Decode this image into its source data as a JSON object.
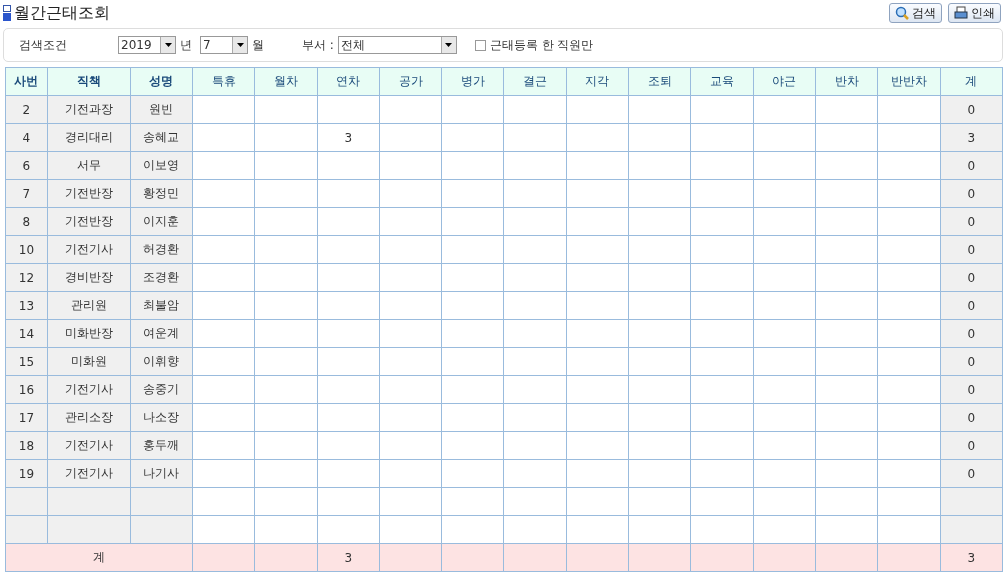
{
  "page": {
    "title": "월간근태조회"
  },
  "toolbar": [
    {
      "kind": "search",
      "label": "검색"
    },
    {
      "kind": "print",
      "label": "인쇄"
    }
  ],
  "filters": {
    "label": "검색조건",
    "year": {
      "value": "2019",
      "unit": "년"
    },
    "month": {
      "value": "7",
      "unit": "월"
    },
    "department": {
      "label": "부서 :",
      "value": "전체"
    },
    "registered_only": {
      "label": "근태등록 한 직원만",
      "checked": false
    }
  },
  "table": {
    "columns": [
      "사번",
      "직책",
      "성명",
      "특휴",
      "월차",
      "연차",
      "공가",
      "병가",
      "결근",
      "지각",
      "조퇴",
      "교육",
      "야근",
      "반차",
      "반반차",
      "계"
    ],
    "rows": [
      {
        "kind": "data",
        "id": "2",
        "position": "기전과장",
        "name": "원빈",
        "total": "0"
      },
      {
        "kind": "data",
        "id": "4",
        "position": "경리대리",
        "name": "송혜교",
        "annual": "3",
        "total": "3"
      },
      {
        "kind": "data",
        "id": "6",
        "position": "서무",
        "name": "이보영",
        "total": "0"
      },
      {
        "kind": "data",
        "id": "7",
        "position": "기전반장",
        "name": "황정민",
        "total": "0"
      },
      {
        "kind": "data",
        "id": "8",
        "position": "기전반장",
        "name": "이지훈",
        "total": "0"
      },
      {
        "kind": "data",
        "id": "10",
        "position": "기전기사",
        "name": "허경환",
        "total": "0"
      },
      {
        "kind": "data",
        "id": "12",
        "position": "경비반장",
        "name": "조경환",
        "total": "0"
      },
      {
        "kind": "data",
        "id": "13",
        "position": "관리원",
        "name": "최불암",
        "total": "0"
      },
      {
        "kind": "data",
        "id": "14",
        "position": "미화반장",
        "name": "여운계",
        "total": "0"
      },
      {
        "kind": "data",
        "id": "15",
        "position": "미화원",
        "name": "이휘향",
        "total": "0"
      },
      {
        "kind": "data",
        "id": "16",
        "position": "기전기사",
        "name": "송중기",
        "total": "0"
      },
      {
        "kind": "data",
        "id": "17",
        "position": "관리소장",
        "name": "나소장",
        "total": "0"
      },
      {
        "kind": "data",
        "id": "18",
        "position": "기전기사",
        "name": "홍두깨",
        "total": "0"
      },
      {
        "kind": "data",
        "id": "19",
        "position": "기전기사",
        "name": "나기사",
        "total": "0"
      },
      {
        "kind": "blank"
      },
      {
        "kind": "blank"
      },
      {
        "kind": "sum",
        "label": "계",
        "annual": "3",
        "total": "3"
      }
    ]
  }
}
